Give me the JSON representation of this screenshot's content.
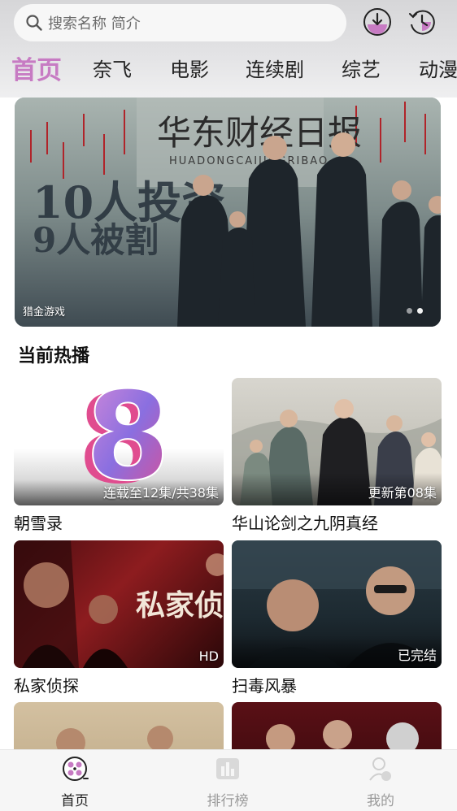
{
  "search": {
    "placeholder": "搜索名称 简介",
    "icon": "search-icon"
  },
  "header_icons": {
    "download": "download-icon",
    "history": "history-icon",
    "accent": "#c77bc3"
  },
  "tabs": [
    {
      "label": "首页",
      "active": true
    },
    {
      "label": "奈飞",
      "active": false
    },
    {
      "label": "电影",
      "active": false
    },
    {
      "label": "连续剧",
      "active": false
    },
    {
      "label": "综艺",
      "active": false
    },
    {
      "label": "动漫",
      "active": false
    }
  ],
  "banner": {
    "caption": "猎金游戏",
    "poster_text_1": "华东财经日报",
    "poster_text_2": "HUADONGCAIJINGRIBAO",
    "poster_text_3": "10人投资",
    "poster_text_4": "9人被割",
    "dots": 2,
    "active_dot": 1
  },
  "section": {
    "title": "当前热播"
  },
  "cards": [
    {
      "title": "朝雪录",
      "badge": "连载至12集/共38集",
      "thumb_text": "8"
    },
    {
      "title": "华山论剑之九阴真经",
      "badge": "更新第08集"
    },
    {
      "title": "私家侦探",
      "badge": "HD",
      "thumb_text": "私家侦"
    },
    {
      "title": "扫毒风暴",
      "badge": "已完结"
    },
    {
      "title": "",
      "badge": ""
    },
    {
      "title": "",
      "badge": ""
    }
  ],
  "bottom_nav": [
    {
      "label": "首页",
      "icon": "film-reel-icon",
      "active": true
    },
    {
      "label": "排行榜",
      "icon": "ranking-chart-icon",
      "active": false
    },
    {
      "label": "我的",
      "icon": "profile-icon",
      "active": false
    }
  ]
}
